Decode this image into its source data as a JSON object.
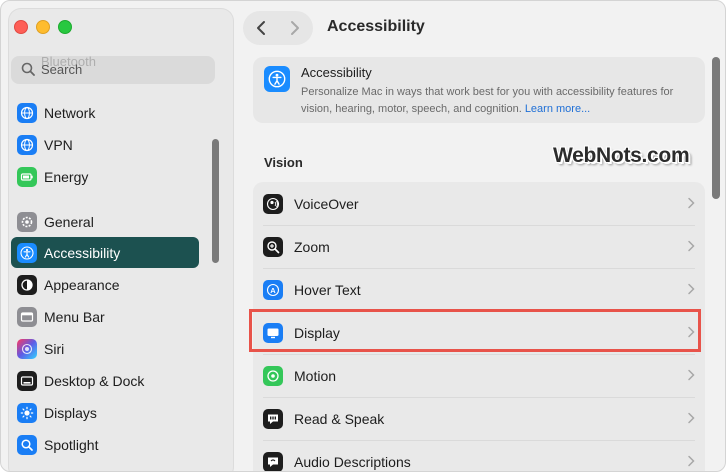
{
  "window": {
    "title": "Accessibility"
  },
  "sidebar": {
    "search_placeholder": "Search",
    "ghost_text": "Bluetooth",
    "items": [
      {
        "label": "Network",
        "icon": "globe-icon",
        "color": "#1a7ef5"
      },
      {
        "label": "VPN",
        "icon": "globe-icon",
        "color": "#1a7ef5"
      },
      {
        "label": "Energy",
        "icon": "battery-icon",
        "color": "#34c759"
      },
      {
        "label": "General",
        "icon": "gear-icon",
        "color": "#8e8e93"
      },
      {
        "label": "Accessibility",
        "icon": "accessibility-icon",
        "color": "#1a8cff",
        "selected": true
      },
      {
        "label": "Appearance",
        "icon": "appearance-icon",
        "color": "#1d1d1d"
      },
      {
        "label": "Menu Bar",
        "icon": "menu-bar-icon",
        "color": "#8e8e93"
      },
      {
        "label": "Siri",
        "icon": "siri-icon",
        "color": "#5e5ce6"
      },
      {
        "label": "Desktop & Dock",
        "icon": "dock-icon",
        "color": "#1d1d1d"
      },
      {
        "label": "Displays",
        "icon": "sun-icon",
        "color": "#1a7ef5"
      },
      {
        "label": "Spotlight",
        "icon": "search-icon",
        "color": "#1a7ef5"
      }
    ]
  },
  "header": {
    "title": "Accessibility",
    "description": "Personalize Mac in ways that work best for you with accessibility features for vision, hearing, motor, speech, and cognition.",
    "link": "Learn more..."
  },
  "section": {
    "title": "Vision"
  },
  "watermark": "WebNots.com",
  "rows": [
    {
      "label": "VoiceOver",
      "icon": "voiceover-icon",
      "color": "#1d1d1d"
    },
    {
      "label": "Zoom",
      "icon": "zoom-icon",
      "color": "#1d1d1d"
    },
    {
      "label": "Hover Text",
      "icon": "hover-text-icon",
      "color": "#1a7ef5"
    },
    {
      "label": "Display",
      "icon": "display-icon",
      "color": "#1a7ef5",
      "highlighted": true
    },
    {
      "label": "Motion",
      "icon": "motion-icon",
      "color": "#34c759"
    },
    {
      "label": "Read & Speak",
      "icon": "speech-bubble-icon",
      "color": "#1d1d1d"
    },
    {
      "label": "Audio Descriptions",
      "icon": "audio-descriptions-icon",
      "color": "#1d1d1d"
    }
  ],
  "colors": {
    "selected_bg": "#1c5150",
    "highlight_border": "#e8534a",
    "accent": "#1a8cff",
    "link": "#1f6fd6"
  }
}
